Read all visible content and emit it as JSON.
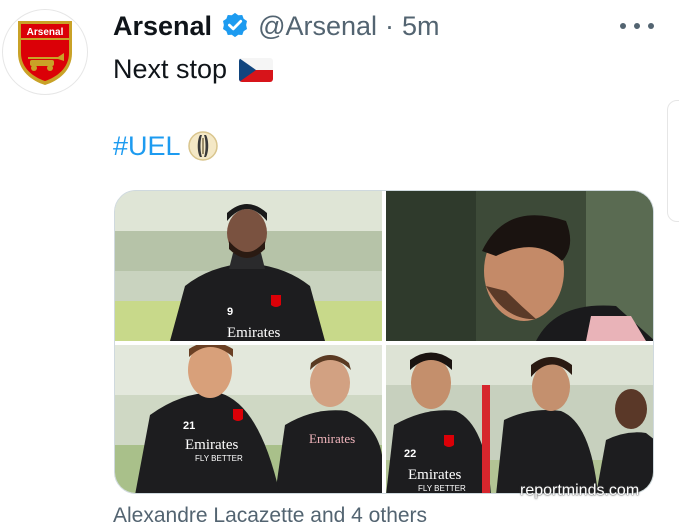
{
  "tweet": {
    "display_name": "Arsenal",
    "handle": "@Arsenal",
    "separator": "·",
    "time": "5m",
    "text": "Next stop",
    "flag_icon": "czech-flag-icon",
    "hashtag": "#UEL",
    "hashtag_icon": "europa-league-trophy-icon",
    "tagged_people": "Alexandre Lacazette and 4 others",
    "watermark": "reportminds.com",
    "photos": [
      {
        "subject": "player-9-jersey",
        "number": "9"
      },
      {
        "subject": "player-profile"
      },
      {
        "subject": "players-21-and-16",
        "number": "21"
      },
      {
        "subject": "players-22-with-pole",
        "number": "22"
      }
    ],
    "jersey_sponsor": "Emirates",
    "jersey_slogan": "FLY BETTER"
  },
  "colors": {
    "link": "#1d9bf0",
    "verified": "#1d9bf0",
    "secondary_text": "#536471",
    "arsenal_red": "#db0007",
    "arsenal_gold": "#c9a227"
  }
}
